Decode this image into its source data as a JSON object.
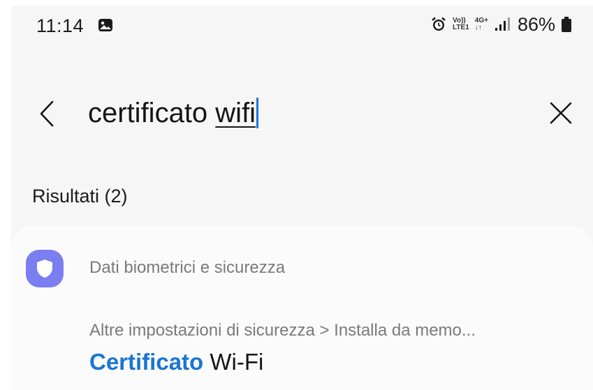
{
  "status_bar": {
    "time": "11:14",
    "net_top": "Vo))",
    "net_bottom": "LTE1",
    "net2_top": "4G+",
    "net2_bottom": "↓↑",
    "battery": "86%"
  },
  "search": {
    "query_plain": "certificato ",
    "query_underlined": "wifi"
  },
  "results": {
    "label": "Risultati (2)",
    "items": [
      {
        "category": "Dati biometrici e sicurezza",
        "path": "Altre impostazioni di sicurezza > Installa da memo...",
        "title_highlight": "Certificato",
        "title_rest": " Wi-Fi"
      }
    ]
  },
  "colors": {
    "accent": "#1976d2",
    "shield_badge": "#7a7ef0",
    "background": "#f6f6f6"
  },
  "icons": [
    "gallery-icon",
    "alarm-icon",
    "signal-icon",
    "battery-icon",
    "back-icon",
    "close-icon",
    "shield-icon"
  ]
}
